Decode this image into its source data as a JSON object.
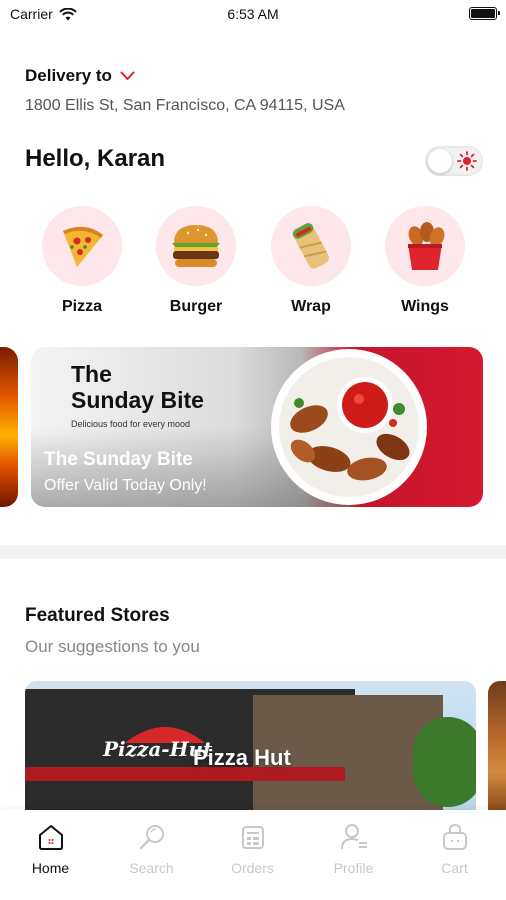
{
  "status_bar": {
    "carrier": "Carrier",
    "time": "6:53 AM"
  },
  "header": {
    "delivery_label": "Delivery to",
    "address": "1800 Ellis St, San Francisco, CA 94115, USA",
    "greeting": "Hello, Karan"
  },
  "theme_toggle": {
    "icon": "sun-icon",
    "state": "off"
  },
  "categories": [
    {
      "label": "Pizza",
      "icon": "pizza-icon"
    },
    {
      "label": "Burger",
      "icon": "burger-icon"
    },
    {
      "label": "Wrap",
      "icon": "wrap-icon"
    },
    {
      "label": "Wings",
      "icon": "wings-icon"
    }
  ],
  "banner": {
    "title": "The\nSunday Bite",
    "tagline": "Delicious food for every mood",
    "headline": "The Sunday Bite",
    "offer": "Offer Valid Today Only!"
  },
  "featured": {
    "title": "Featured Stores",
    "subtitle": "Our suggestions to you",
    "stores": [
      {
        "name": "Pizza Hut",
        "logo_text": "Pizza-Hut"
      }
    ]
  },
  "bottom_nav": [
    {
      "label": "Home",
      "icon": "home-icon",
      "active": true
    },
    {
      "label": "Search",
      "icon": "search-icon",
      "active": false
    },
    {
      "label": "Orders",
      "icon": "orders-icon",
      "active": false
    },
    {
      "label": "Profile",
      "icon": "profile-icon",
      "active": false
    },
    {
      "label": "Cart",
      "icon": "cart-icon",
      "active": false
    }
  ],
  "colors": {
    "accent": "#e0202e",
    "category_bg": "#fde7ea",
    "inactive_nav": "#c8c8c8"
  }
}
